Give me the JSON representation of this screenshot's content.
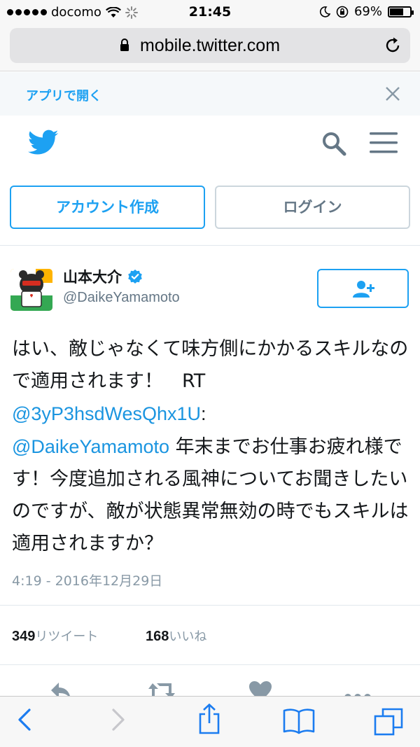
{
  "status_bar": {
    "carrier": "docomo",
    "time": "21:45",
    "battery": "69%",
    "battery_level": 0.69
  },
  "browser": {
    "url": "mobile.twitter.com"
  },
  "app_banner": {
    "label": "アプリで開く"
  },
  "auth": {
    "signup_label": "アカウント作成",
    "login_label": "ログイン"
  },
  "tweet": {
    "display_name": "山本大介",
    "username": "@DaikeYamamoto",
    "text_1": "はい、敵じゃなくて味方側にかかるスキルなので適用されます！　RT",
    "mention_1": "@3yP3hsdWesQhx1U",
    "colon": ":",
    "mention_2": "@DaikeYamamoto",
    "text_2": " 年末までお仕事お疲れ様です！今度追加される風神についてお聞きしたいのですが、敵が状態異常無効の時でもスキルは適用されますか？",
    "timestamp": "4:19 - 2016年12月29日",
    "retweet_count": "349",
    "retweet_label": "リツイート",
    "like_count": "168",
    "like_label": "いいね"
  },
  "colors": {
    "accent": "#1da1f2",
    "link": "#1b95e0",
    "muted": "#8899a6",
    "icon_gray": "#657786"
  }
}
